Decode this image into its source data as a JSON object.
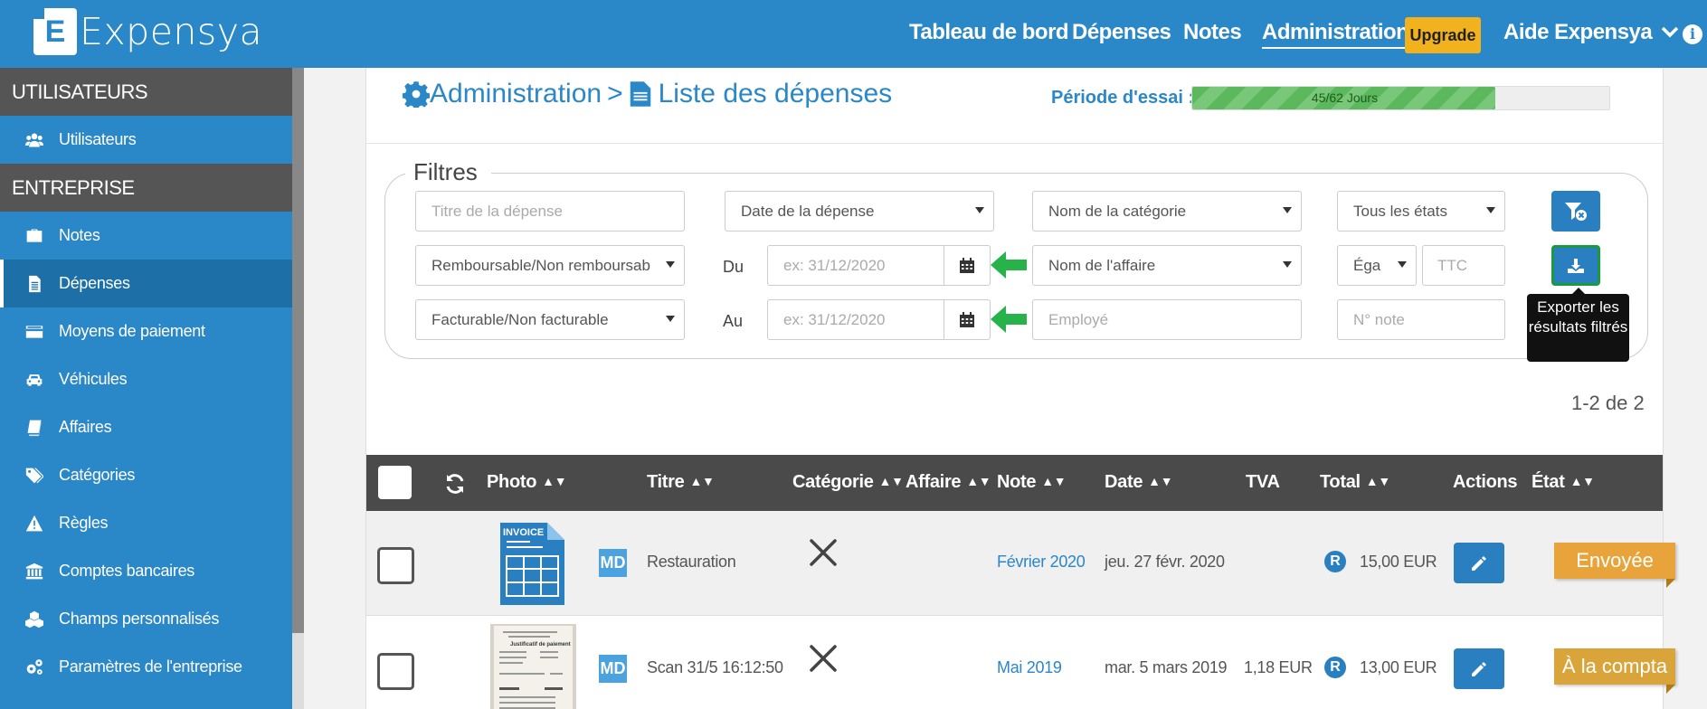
{
  "app": {
    "name": "Expensya",
    "logo_letter": "E"
  },
  "topnav": {
    "items": [
      "Tableau de bord",
      "Dépenses",
      "Notes",
      "Administration"
    ],
    "active": "Administration",
    "upgrade_label": "Upgrade",
    "help_label": "Aide Expensya",
    "info_icon": "i"
  },
  "sidebar": {
    "section_users": "UTILISATEURS",
    "section_company": "ENTREPRISE",
    "users_items": [
      {
        "label": "Utilisateurs",
        "icon": "users-icon"
      }
    ],
    "company_items": [
      {
        "label": "Notes",
        "icon": "briefcase-icon"
      },
      {
        "label": "Dépenses",
        "icon": "document-icon",
        "active": true
      },
      {
        "label": "Moyens de paiement",
        "icon": "credit-card-icon"
      },
      {
        "label": "Véhicules",
        "icon": "car-icon"
      },
      {
        "label": "Affaires",
        "icon": "book-icon"
      },
      {
        "label": "Catégories",
        "icon": "tags-icon"
      },
      {
        "label": "Règles",
        "icon": "warning-icon"
      },
      {
        "label": "Comptes bancaires",
        "icon": "bank-icon"
      },
      {
        "label": "Champs personnalisés",
        "icon": "cubes-icon"
      },
      {
        "label": "Paramètres de l'entreprise",
        "icon": "cogs-icon"
      }
    ]
  },
  "header": {
    "breadcrumb_root": "Administration",
    "breadcrumb_sep": ">",
    "breadcrumb_current": "Liste des dépenses",
    "trial_label": "Période d'essai :",
    "trial_text": "45/62 Jours",
    "trial_progress": 0.7258
  },
  "filters": {
    "legend": "Filtres",
    "title_placeholder": "Titre de la dépense",
    "date_select": "Date de la dépense",
    "category_select": "Nom de la catégorie",
    "state_select": "Tous les états",
    "reimbursable_select": "Remboursable/Non remboursab",
    "from_label": "Du",
    "from_placeholder": "ex: 31/12/2020",
    "project_select": "Nom de l'affaire",
    "comparator_select": "Éga",
    "ttc_placeholder": "TTC",
    "billable_select": "Facturable/Non facturable",
    "to_label": "Au",
    "to_placeholder": "ex: 31/12/2020",
    "employee_placeholder": "Employé",
    "note_placeholder": "N° note",
    "export_tooltip": "Exporter les résultats filtrés"
  },
  "results": {
    "count_text": "1-2 de 2"
  },
  "table": {
    "columns": [
      "Photo",
      "Titre",
      "Catégorie",
      "Affaire",
      "Note",
      "Date",
      "TVA",
      "Total",
      "Actions",
      "État"
    ],
    "rows": [
      {
        "photo": "invoice-icon",
        "photo_label": "INVOICE",
        "md": "MD",
        "title": "Restauration",
        "category_icon": "cutlery-icon",
        "project": "",
        "note": "Février 2020",
        "date": "jeu. 27 févr. 2020",
        "tva": "",
        "total_badge": "R",
        "total": "15,00 EUR",
        "status": "Envoyée",
        "status_color": "#e8a43a"
      },
      {
        "photo": "receipt-photo",
        "photo_label": "Justificatif de paiement",
        "md": "MD",
        "title": "Scan 31/5 16:12:50",
        "category_icon": "cutlery-icon",
        "project": "",
        "note": "Mai 2019",
        "date": "mar. 5 mars 2019",
        "tva": "1,18 EUR",
        "total_badge": "R",
        "total": "13,00 EUR",
        "status": "À la compta",
        "status_color": "#d9a43a"
      }
    ]
  },
  "colors": {
    "brand": "#2a87c8",
    "sidebar_active": "#1d6fa8",
    "upgrade": "#f1b21e",
    "green_arrow": "#27b34a"
  }
}
